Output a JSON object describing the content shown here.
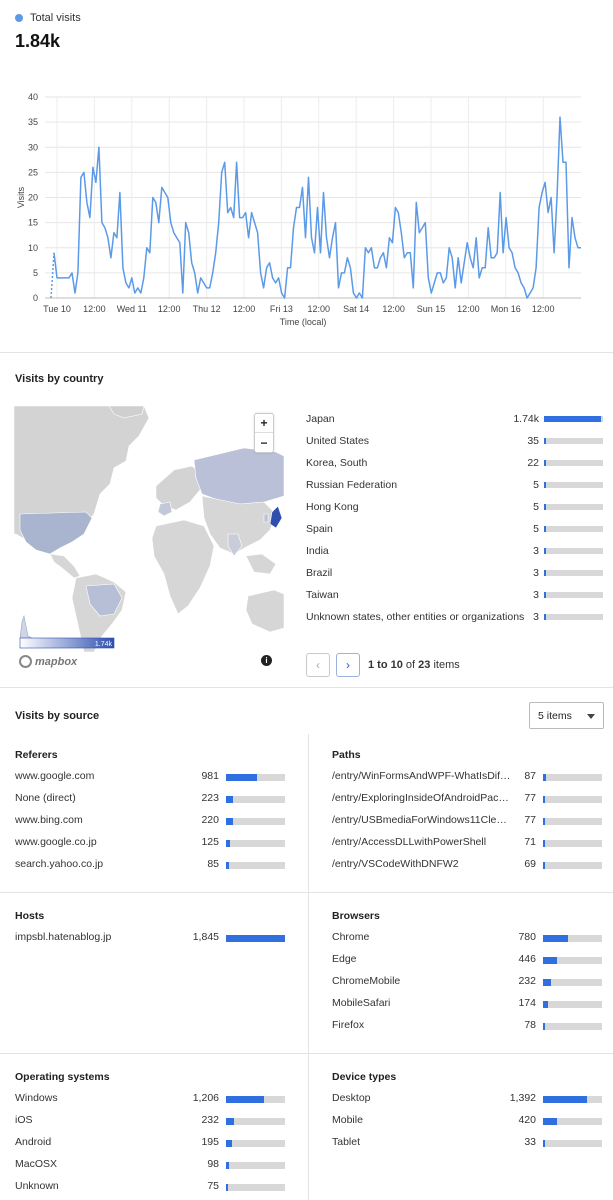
{
  "summary": {
    "legend_label": "Total visits",
    "legend_color": "#5b9ae8",
    "total": "1.84k"
  },
  "chart_data": {
    "type": "line",
    "xlabel": "Time (local)",
    "ylabel": "Visits",
    "ylim": [
      0,
      40
    ],
    "yticks": [
      0,
      5,
      10,
      15,
      20,
      25,
      30,
      35,
      40
    ],
    "x_tick_labels": [
      "Tue 10",
      "12:00",
      "Wed 11",
      "12:00",
      "Thu 12",
      "12:00",
      "Fri 13",
      "12:00",
      "Sat 14",
      "12:00",
      "Sun 15",
      "12:00",
      "Mon 16",
      "12:00"
    ],
    "grid": true,
    "color": "#5b9ae8",
    "series": [
      {
        "values": [
          0,
          9,
          4,
          4,
          4,
          4,
          4,
          5,
          1,
          5,
          24,
          25,
          19,
          16,
          26,
          23,
          30,
          15,
          14,
          12,
          8,
          13,
          12,
          21,
          6,
          3,
          2,
          4,
          1,
          2,
          1,
          4,
          10,
          9,
          20,
          19,
          15,
          22,
          21,
          20,
          15,
          13,
          12,
          11,
          1,
          15,
          13,
          7,
          5,
          1,
          4,
          3,
          2,
          2,
          5,
          9,
          15,
          25,
          27,
          17,
          18,
          16,
          27,
          16,
          16,
          17,
          12,
          17,
          15,
          13,
          5,
          2,
          6,
          7,
          4,
          3,
          4,
          1,
          0,
          6,
          6,
          14,
          18,
          18,
          22,
          12,
          24,
          12,
          9,
          18,
          9,
          21,
          12,
          8,
          12,
          15,
          2,
          5,
          5,
          8,
          6,
          1,
          0,
          1,
          0,
          10,
          9,
          10,
          6,
          6,
          8,
          9,
          6,
          12,
          11,
          18,
          17,
          13,
          8,
          9,
          9,
          2,
          19,
          13,
          14,
          15,
          4,
          1,
          3,
          5,
          5,
          3,
          4,
          10,
          8,
          2,
          8,
          3,
          7,
          11,
          8,
          6,
          12,
          4,
          6,
          6,
          14,
          8,
          8,
          9,
          21,
          9,
          16,
          10,
          9,
          6,
          5,
          3,
          2,
          0,
          1,
          2,
          6,
          18,
          21,
          23,
          17,
          20,
          9,
          20,
          36,
          27,
          27,
          6,
          16,
          12,
          10,
          10
        ]
      }
    ]
  },
  "country_section": {
    "title": "Visits by country",
    "map_legend_max": "1.74k",
    "mapbox_label": "mapbox",
    "zoom_in": "+",
    "zoom_out": "−",
    "info": "i",
    "rows": [
      {
        "name": "Japan",
        "value": "1.74k",
        "fraction": 0.96
      },
      {
        "name": "United States",
        "value": "35",
        "fraction": 0.04
      },
      {
        "name": "Korea, South",
        "value": "22",
        "fraction": 0.03
      },
      {
        "name": "Russian Federation",
        "value": "5",
        "fraction": 0.02
      },
      {
        "name": "Hong Kong",
        "value": "5",
        "fraction": 0.02
      },
      {
        "name": "Spain",
        "value": "5",
        "fraction": 0.02
      },
      {
        "name": "India",
        "value": "3",
        "fraction": 0.015
      },
      {
        "name": "Brazil",
        "value": "3",
        "fraction": 0.015
      },
      {
        "name": "Taiwan",
        "value": "3",
        "fraction": 0.015
      },
      {
        "name": "Unknown states, other entities or organizations",
        "value": "3",
        "fraction": 0.015
      }
    ],
    "pager": {
      "prev": "‹",
      "next": "›",
      "range": "1 to 10",
      "of_word": "of",
      "total": "23",
      "items_word": "items"
    }
  },
  "source_section": {
    "title": "Visits by source",
    "select_value": "5 items",
    "panels": {
      "referers": {
        "title": "Referers",
        "rows": [
          {
            "name": "www.google.com",
            "value": "981",
            "fraction": 0.53
          },
          {
            "name": "None (direct)",
            "value": "223",
            "fraction": 0.12
          },
          {
            "name": "www.bing.com",
            "value": "220",
            "fraction": 0.12
          },
          {
            "name": "www.google.co.jp",
            "value": "125",
            "fraction": 0.07
          },
          {
            "name": "search.yahoo.co.jp",
            "value": "85",
            "fraction": 0.05
          }
        ]
      },
      "paths": {
        "title": "Paths",
        "rows": [
          {
            "name": "/entry/WinFormsAndWPF-WhatIsDiffe...",
            "value": "87",
            "fraction": 0.05
          },
          {
            "name": "/entry/ExploringInsideOfAndroidPacka...",
            "value": "77",
            "fraction": 0.04
          },
          {
            "name": "/entry/USBmediaForWindows11Cleanl...",
            "value": "77",
            "fraction": 0.04
          },
          {
            "name": "/entry/AccessDLLwithPowerShell",
            "value": "71",
            "fraction": 0.04
          },
          {
            "name": "/entry/VSCodeWithDNFW2",
            "value": "69",
            "fraction": 0.04
          }
        ]
      },
      "hosts": {
        "title": "Hosts",
        "rows": [
          {
            "name": "impsbl.hatenablog.jp",
            "value": "1,845",
            "fraction": 1.0
          }
        ]
      },
      "browsers": {
        "title": "Browsers",
        "rows": [
          {
            "name": "Chrome",
            "value": "780",
            "fraction": 0.42
          },
          {
            "name": "Edge",
            "value": "446",
            "fraction": 0.24
          },
          {
            "name": "ChromeMobile",
            "value": "232",
            "fraction": 0.13
          },
          {
            "name": "MobileSafari",
            "value": "174",
            "fraction": 0.09
          },
          {
            "name": "Firefox",
            "value": "78",
            "fraction": 0.04
          }
        ]
      },
      "os": {
        "title": "Operating systems",
        "rows": [
          {
            "name": "Windows",
            "value": "1,206",
            "fraction": 0.65
          },
          {
            "name": "iOS",
            "value": "232",
            "fraction": 0.13
          },
          {
            "name": "Android",
            "value": "195",
            "fraction": 0.11
          },
          {
            "name": "MacOSX",
            "value": "98",
            "fraction": 0.05
          },
          {
            "name": "Unknown",
            "value": "75",
            "fraction": 0.04
          }
        ]
      },
      "devices": {
        "title": "Device types",
        "rows": [
          {
            "name": "Desktop",
            "value": "1,392",
            "fraction": 0.75
          },
          {
            "name": "Mobile",
            "value": "420",
            "fraction": 0.23
          },
          {
            "name": "Tablet",
            "value": "33",
            "fraction": 0.02
          }
        ]
      }
    }
  }
}
